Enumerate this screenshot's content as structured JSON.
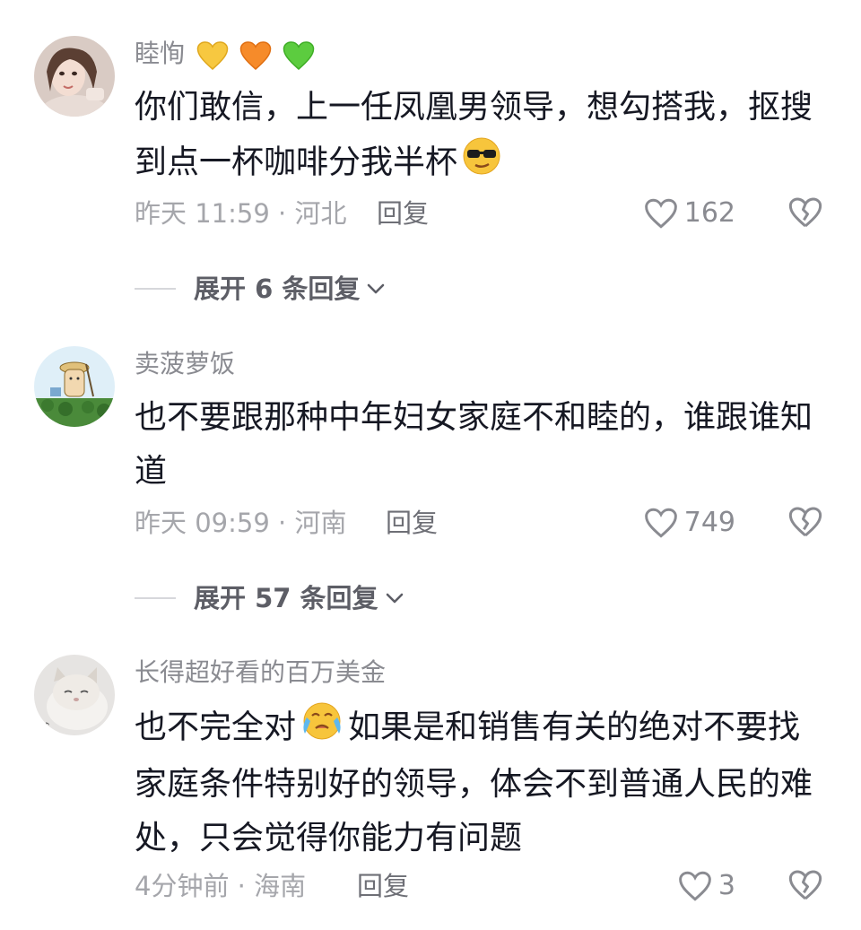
{
  "comments": [
    {
      "username": "睦恂",
      "badges": [
        "yellow-heart-icon",
        "orange-heart-icon",
        "green-heart-icon"
      ],
      "text": "你们敢信，上一任凤凰男领导，想勾搭我，抠搜到点一杯咖啡分我半杯",
      "emoji": "sunglasses-emoji",
      "time": "昨天 11:59",
      "location": "河北",
      "meta": "昨天 11:59 · 河北",
      "reply_label": "回复",
      "likes": "162",
      "expand_label": "展开 6 条回复"
    },
    {
      "username": "卖菠萝饭",
      "text": "也不要跟那种中年妇女家庭不和睦的，谁跟谁知道",
      "time": "昨天 09:59",
      "location": "河南",
      "meta": "昨天 09:59 · 河南",
      "reply_label": "回复",
      "likes": "749",
      "expand_label": "展开 57 条回复"
    },
    {
      "username": "长得超好看的百万美金",
      "text_before": "也不完全对",
      "emoji": "crying-emoji",
      "text_after": "如果是和销售有关的绝对不要找家庭条件特别好的领导，体会不到普通人民的难处，只会觉得你能力有问题",
      "time": "4分钟前",
      "location": "海南",
      "meta": "4分钟前 · 海南",
      "reply_label": "回复",
      "likes": "3"
    }
  ],
  "colors": {
    "primary_text": "#161823",
    "secondary_text": "#8a8b91",
    "meta_text": "#a5a6ab"
  }
}
